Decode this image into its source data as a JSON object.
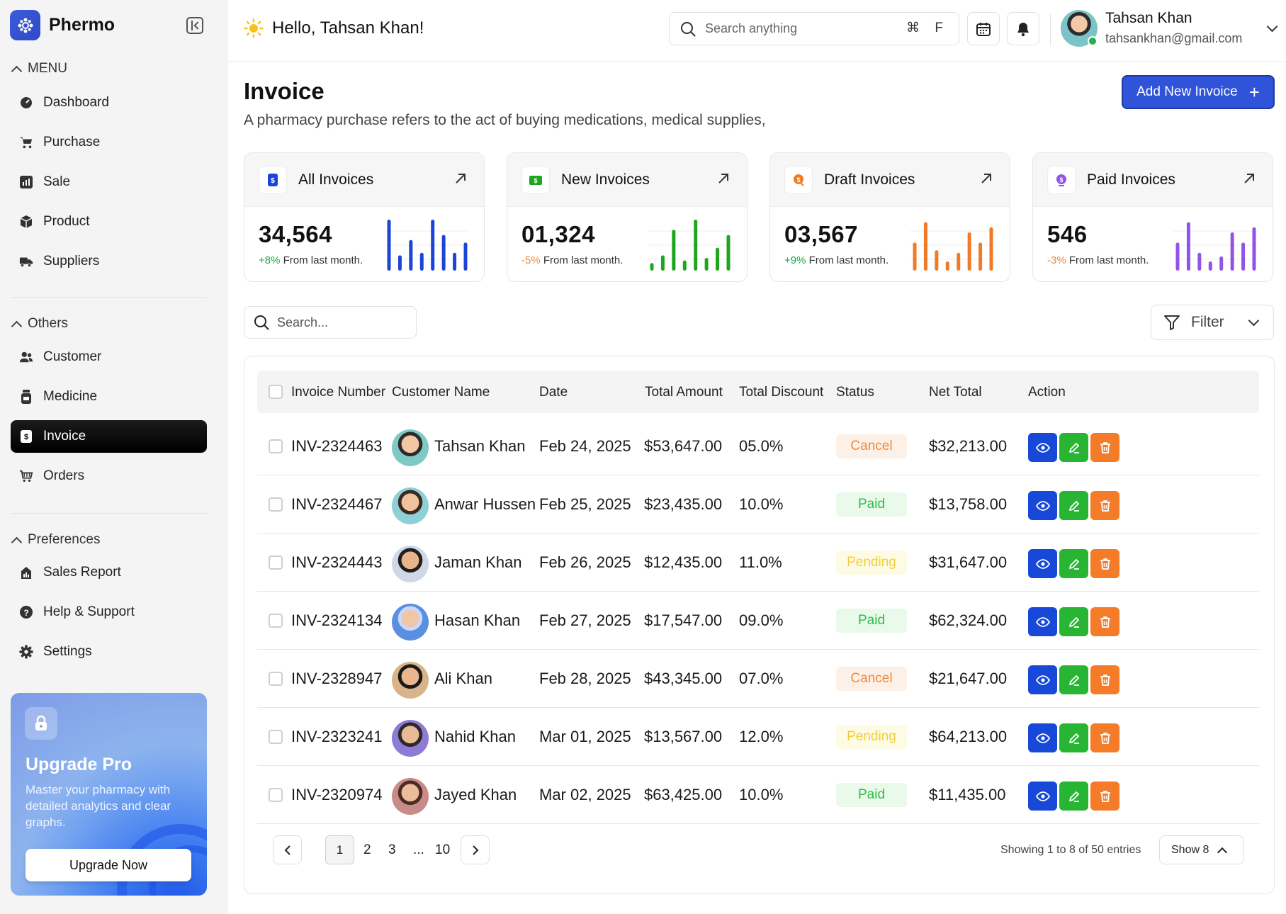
{
  "brand": {
    "name": "Phermo"
  },
  "sidebar": {
    "menu_label": "MENU",
    "menu_items": [
      {
        "label": "Dashboard",
        "icon": "dashboard-icon"
      },
      {
        "label": "Purchase",
        "icon": "cart-icon"
      },
      {
        "label": "Sale",
        "icon": "chart-icon"
      },
      {
        "label": "Product",
        "icon": "box-icon"
      },
      {
        "label": "Suppliers",
        "icon": "truck-icon"
      }
    ],
    "others_label": "Others",
    "others_items": [
      {
        "label": "Customer",
        "icon": "users-icon"
      },
      {
        "label": "Medicine",
        "icon": "bottle-icon"
      },
      {
        "label": "Invoice",
        "icon": "invoice-icon",
        "active": true
      },
      {
        "label": "Orders",
        "icon": "basket-icon"
      }
    ],
    "pref_label": "Preferences",
    "pref_items": [
      {
        "label": "Sales Report",
        "icon": "report-icon"
      },
      {
        "label": "Help & Support",
        "icon": "help-icon"
      },
      {
        "label": "Settings",
        "icon": "gear-icon"
      }
    ],
    "upgrade": {
      "title": "Upgrade Pro",
      "text": "Master your pharmacy with detailed analytics and clear graphs.",
      "button": "Upgrade Now"
    }
  },
  "header": {
    "greeting": "Hello, Tahsan Khan!",
    "search_placeholder": "Search anything",
    "shortcut": "⌘ F",
    "user_name": "Tahsan Khan",
    "user_email": "tahsankhan@gmail.com"
  },
  "page": {
    "title": "Invoice",
    "subtitle": "A pharmacy purchase refers to the act of buying medications, medical supplies,",
    "add_button": "Add New Invoice"
  },
  "cards": [
    {
      "title": "All Invoices",
      "value": "34,564",
      "change": "+8%",
      "change_suffix": " From last month.",
      "trend": "pos",
      "color": "#1d44d8",
      "bars": [
        1.0,
        0.3,
        0.6,
        0.35,
        1.0,
        0.7,
        0.35,
        0.55
      ]
    },
    {
      "title": "New Invoices",
      "value": "01,324",
      "change": "-5%",
      "change_suffix": " From last month.",
      "trend": "neg",
      "color": "#1fa61f",
      "bars": [
        0.15,
        0.3,
        0.8,
        0.2,
        1.0,
        0.25,
        0.45,
        0.7
      ]
    },
    {
      "title": "Draft Invoices",
      "value": "03,567",
      "change": "+9%",
      "change_suffix": " From last month.",
      "trend": "pos",
      "color": "#f07a26",
      "bars": [
        0.55,
        0.95,
        0.4,
        0.18,
        0.35,
        0.75,
        0.55,
        0.85
      ]
    },
    {
      "title": "Paid Invoices",
      "value": "546",
      "change": "-3%",
      "change_suffix": " From last month.",
      "trend": "neg",
      "color": "#9353e8",
      "bars": [
        0.55,
        0.95,
        0.35,
        0.18,
        0.28,
        0.75,
        0.55,
        0.85
      ]
    }
  ],
  "list": {
    "search_placeholder": "Search...",
    "filter_label": "Filter"
  },
  "table": {
    "headers": [
      "Invoice Number",
      "Customer Name",
      "Date",
      "Total Amount",
      "Total Discount",
      "Status",
      "Net Total",
      "Action"
    ],
    "rows": [
      {
        "invoice": "INV-2324463",
        "customer": "Tahsan Khan",
        "date": "Feb 24, 2025",
        "total": "$53,647.00",
        "discount": "05.0%",
        "status": "Cancel",
        "net": "$32,213.00"
      },
      {
        "invoice": "INV-2324467",
        "customer": "Anwar Hussen",
        "date": "Feb 25, 2025",
        "total": "$23,435.00",
        "discount": "10.0%",
        "status": "Paid",
        "net": "$13,758.00"
      },
      {
        "invoice": "INV-2324443",
        "customer": "Jaman Khan",
        "date": "Feb 26, 2025",
        "total": "$12,435.00",
        "discount": "11.0%",
        "status": "Pending",
        "net": "$31,647.00"
      },
      {
        "invoice": "INV-2324134",
        "customer": "Hasan Khan",
        "date": "Feb 27, 2025",
        "total": "$17,547.00",
        "discount": "09.0%",
        "status": "Paid",
        "net": "$62,324.00"
      },
      {
        "invoice": "INV-2328947",
        "customer": "Ali Khan",
        "date": "Feb 28, 2025",
        "total": "$43,345.00",
        "discount": "07.0%",
        "status": "Cancel",
        "net": "$21,647.00"
      },
      {
        "invoice": "INV-2323241",
        "customer": "Nahid Khan",
        "date": "Mar 01, 2025",
        "total": "$13,567.00",
        "discount": "12.0%",
        "status": "Pending",
        "net": "$64,213.00"
      },
      {
        "invoice": "INV-2320974",
        "customer": "Jayed Khan",
        "date": "Mar 02, 2025",
        "total": "$63,425.00",
        "discount": "10.0%",
        "status": "Paid",
        "net": "$11,435.00"
      }
    ]
  },
  "pagination": {
    "pages": [
      "1",
      "2",
      "3",
      "...",
      "10"
    ],
    "current": "1",
    "showing": "Showing 1 to 8 of 50 entries",
    "show_label": "Show 8"
  }
}
